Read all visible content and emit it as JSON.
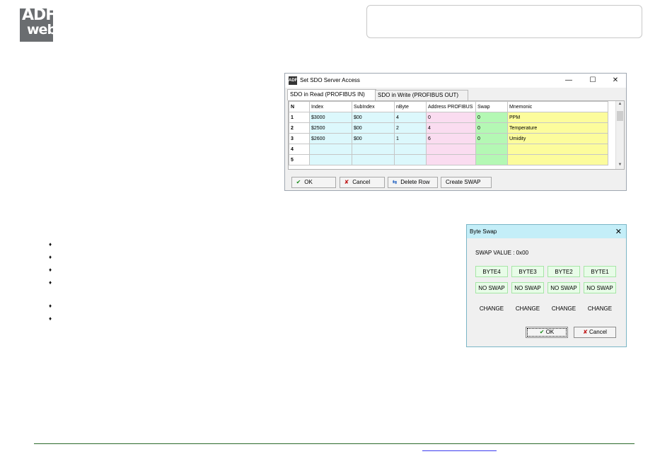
{
  "logo": {
    "line1": "ADF",
    "line2": "web"
  },
  "sdo_window": {
    "title": "Set SDO Server Access",
    "controls": {
      "minimize": "—",
      "maximize": "☐",
      "close": "✕"
    },
    "tabs": [
      {
        "label": "SDO in Read (PROFIBUS IN)",
        "active": true
      },
      {
        "label": "SDO in Write (PROFIBUS OUT)",
        "active": false
      }
    ],
    "columns": [
      "N",
      "Index",
      "SubIndex",
      "nByte",
      "Address PROFIBUS",
      "Swap",
      "Mnemonic"
    ],
    "rows": [
      {
        "n": "1",
        "index": "$3000",
        "subindex": "$00",
        "nbyte": "4",
        "address": "0",
        "swap": "0",
        "mnemonic": "PPM"
      },
      {
        "n": "2",
        "index": "$2500",
        "subindex": "$00",
        "nbyte": "2",
        "address": "4",
        "swap": "0",
        "mnemonic": "Temperature"
      },
      {
        "n": "3",
        "index": "$2600",
        "subindex": "$00",
        "nbyte": "1",
        "address": "6",
        "swap": "0",
        "mnemonic": "Umidity"
      },
      {
        "n": "4",
        "index": "",
        "subindex": "",
        "nbyte": "",
        "address": "",
        "swap": "",
        "mnemonic": ""
      },
      {
        "n": "5",
        "index": "",
        "subindex": "",
        "nbyte": "",
        "address": "",
        "swap": "",
        "mnemonic": ""
      }
    ],
    "buttons": {
      "ok": "OK",
      "cancel": "Cancel",
      "delete_row": "Delete Row",
      "create_swap": "Create SWAP"
    }
  },
  "byte_swap_dialog": {
    "title": "Byte Swap",
    "close": "✕",
    "swap_value_label": "SWAP VALUE :",
    "swap_value": "0x00",
    "bytes": [
      "BYTE4",
      "BYTE3",
      "BYTE2",
      "BYTE1"
    ],
    "states": [
      "NO SWAP",
      "NO SWAP",
      "NO SWAP",
      "NO SWAP"
    ],
    "change_labels": [
      "CHANGE",
      "CHANGE",
      "CHANGE",
      "CHANGE"
    ],
    "buttons": {
      "ok": "OK",
      "cancel": "Cancel"
    }
  },
  "bullets": {
    "glyph": "♦"
  },
  "colors": {
    "cyan": "#dcf8fc",
    "pink": "#fadcf0",
    "green": "#b4f8b4",
    "yellow": "#fcfc9c",
    "footer": "#2b6a2b"
  }
}
